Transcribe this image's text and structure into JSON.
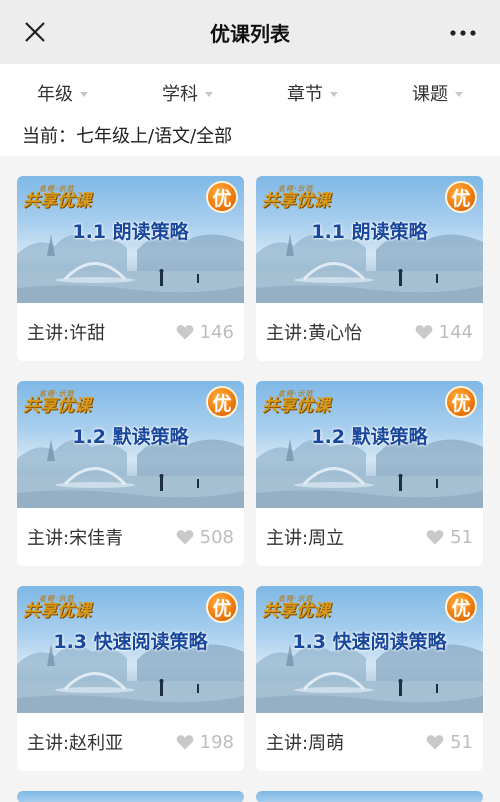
{
  "header": {
    "title": "优课列表"
  },
  "filters": [
    {
      "label": "年级"
    },
    {
      "label": "学科"
    },
    {
      "label": "章节"
    },
    {
      "label": "课题"
    }
  ],
  "current": "当前：七年级上/语文/全部",
  "brand": {
    "main": "共享优课",
    "sub": "名师·示范"
  },
  "badge": "优",
  "colors": {
    "header_bg": "#ededed",
    "page_bg": "#f4f4f4",
    "card_bg": "#ffffff",
    "thumb_title": "#18479b",
    "badge": "#f07d0f",
    "likes_gray": "#bdbdbd"
  },
  "courses": [
    {
      "title": "1.1 朗读策略",
      "speaker": "主讲:许甜",
      "likes": "146"
    },
    {
      "title": "1.1 朗读策略",
      "speaker": "主讲:黄心怡",
      "likes": "144"
    },
    {
      "title": "1.2 默读策略",
      "speaker": "主讲:宋佳青",
      "likes": "508"
    },
    {
      "title": "1.2 默读策略",
      "speaker": "主讲:周立",
      "likes": "51"
    },
    {
      "title": "1.3 快速阅读策略",
      "speaker": "主讲:赵利亚",
      "likes": "198"
    },
    {
      "title": "1.3 快速阅读策略",
      "speaker": "主讲:周萌",
      "likes": "51"
    }
  ]
}
